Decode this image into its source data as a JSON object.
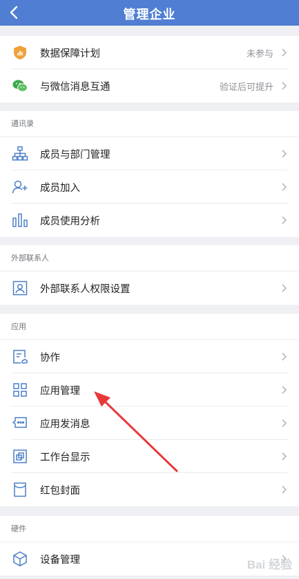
{
  "nav": {
    "title": "管理企业",
    "back_icon": "chevron-left-icon"
  },
  "group1": {
    "items": [
      {
        "label": "数据保障计划",
        "value": "未参与",
        "icon": "shield-icon",
        "icon_color": "#f0a23a"
      },
      {
        "label": "与微信消息互通",
        "value": "验证后可提升",
        "icon": "wechat-icon",
        "icon_color": "#3aa84a"
      }
    ]
  },
  "contacts": {
    "header": "通讯录",
    "items": [
      {
        "label": "成员与部门管理",
        "icon": "org-chart-icon"
      },
      {
        "label": "成员加入",
        "icon": "add-member-icon"
      },
      {
        "label": "成员使用分析",
        "icon": "bar-chart-icon"
      }
    ]
  },
  "external": {
    "header": "外部联系人",
    "items": [
      {
        "label": "外部联系人权限设置",
        "icon": "contact-card-icon"
      }
    ]
  },
  "apps": {
    "header": "应用",
    "items": [
      {
        "label": "协作",
        "icon": "collaboration-icon"
      },
      {
        "label": "应用管理",
        "icon": "app-grid-icon"
      },
      {
        "label": "应用发消息",
        "icon": "message-icon"
      },
      {
        "label": "工作台显示",
        "icon": "workbench-icon"
      },
      {
        "label": "红包封面",
        "icon": "red-envelope-icon"
      }
    ]
  },
  "hardware": {
    "header": "硬件",
    "items": [
      {
        "label": "设备管理",
        "icon": "device-cube-icon"
      }
    ]
  },
  "annotation": {
    "color": "#e8383b",
    "target": "应用管理"
  },
  "watermark": {
    "text": "Bai 经验"
  },
  "colors": {
    "nav_bg": "#4f7ed2",
    "page_bg": "#eef0f3",
    "icon_blue": "#4a7fc8"
  }
}
